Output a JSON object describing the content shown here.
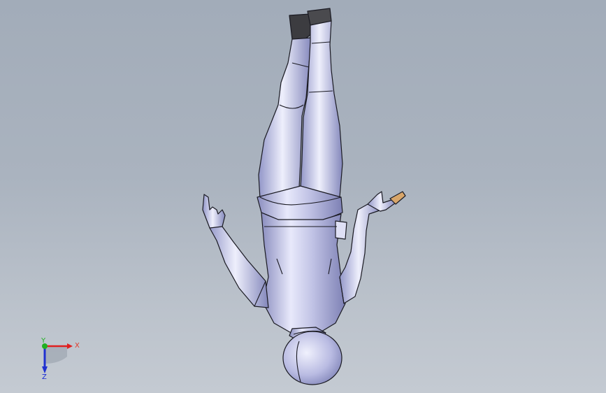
{
  "viewport": {
    "background_top": "#a2acb9",
    "background_bottom": "#c4cad2",
    "model_color": "#c9cbe8",
    "edge_color": "#1a1a22"
  },
  "triad": {
    "x_label": "X",
    "y_label": "Y",
    "z_label": "Z",
    "x_color": "#e02020",
    "y_color": "#20b020",
    "z_color": "#2030d0"
  }
}
